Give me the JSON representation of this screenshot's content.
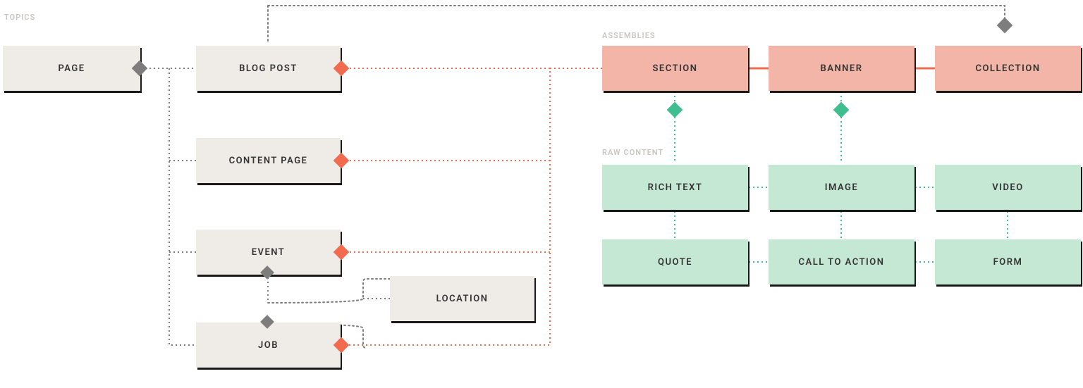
{
  "sections": {
    "topics_label": "TOPICS",
    "assemblies_label": "ASSEMBLIES",
    "raw_content_label": "RAW CONTENT"
  },
  "boxes": {
    "page": "PAGE",
    "blog_post": "BLOG POST",
    "content_page": "CONTENT PAGE",
    "event": "EVENT",
    "location": "LOCATION",
    "job": "JOB",
    "section": "SECTION",
    "banner": "BANNER",
    "collection": "COLLECTION",
    "rich_text": "RICH TEXT",
    "image": "IMAGE",
    "video": "VIDEO",
    "quote": "QUOTE",
    "call_to_action": "CALL TO ACTION",
    "form": "FORM"
  },
  "colors": {
    "cream": "#efece7",
    "salmon": "#f2b5a7",
    "mint": "#c5e8d5",
    "gray_line": "#7d7d7d",
    "orange_line": "#f26b4e",
    "green_line": "#3fbf8f"
  }
}
